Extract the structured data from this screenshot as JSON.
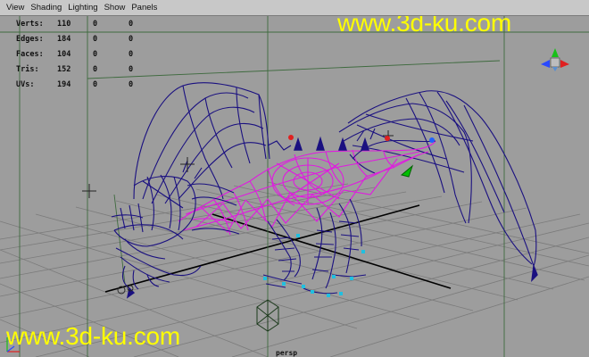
{
  "menubar": {
    "items": [
      {
        "label": "View"
      },
      {
        "label": "Shading"
      },
      {
        "label": "Lighting"
      },
      {
        "label": "Show"
      },
      {
        "label": "Panels"
      }
    ]
  },
  "hud": {
    "rows": [
      {
        "label": "Verts:",
        "values": [
          "110",
          "0",
          "0"
        ]
      },
      {
        "label": "Edges:",
        "values": [
          "184",
          "0",
          "0"
        ]
      },
      {
        "label": "Faces:",
        "values": [
          "104",
          "0",
          "0"
        ]
      },
      {
        "label": "Tris:",
        "values": [
          "152",
          "0",
          "0"
        ]
      },
      {
        "label": "UVs:",
        "values": [
          "194",
          "0",
          "0"
        ]
      }
    ]
  },
  "watermark": {
    "text": "www.3d-ku.com"
  },
  "camera_label": "persp",
  "colors": {
    "viewport_bg": "#9d9d9d",
    "grid": "#7c7c7c",
    "grid_axis": "#000000",
    "wire_blue": "#1a1080",
    "wire_magenta": "#e01ae0",
    "watermark": "#ffff00",
    "camera_green": "#1c3a1c"
  },
  "icons": {
    "view_cube": "axis-gizmo-icon",
    "camera": "camera-icon"
  }
}
